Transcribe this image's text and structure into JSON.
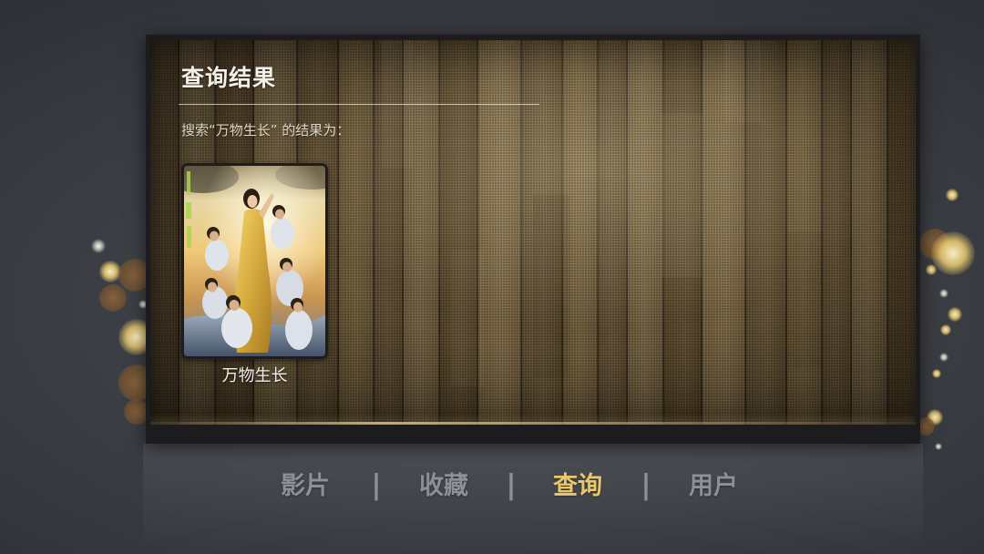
{
  "header": {
    "title": "查询结果"
  },
  "search": {
    "summary": "搜索“万物生长” 的结果为："
  },
  "results": [
    {
      "title": "万物生长"
    }
  ],
  "nav": {
    "separator": "|",
    "items": [
      {
        "label": "影片",
        "active": false
      },
      {
        "label": "收藏",
        "active": false
      },
      {
        "label": "查询",
        "active": true
      },
      {
        "label": "用户",
        "active": false
      }
    ]
  },
  "colors": {
    "accent": "#e8c868",
    "nav_inactive": "#8d9097",
    "background": "#3d4047",
    "panel_border": "#1c1c1e",
    "wood": "#6a5837"
  }
}
